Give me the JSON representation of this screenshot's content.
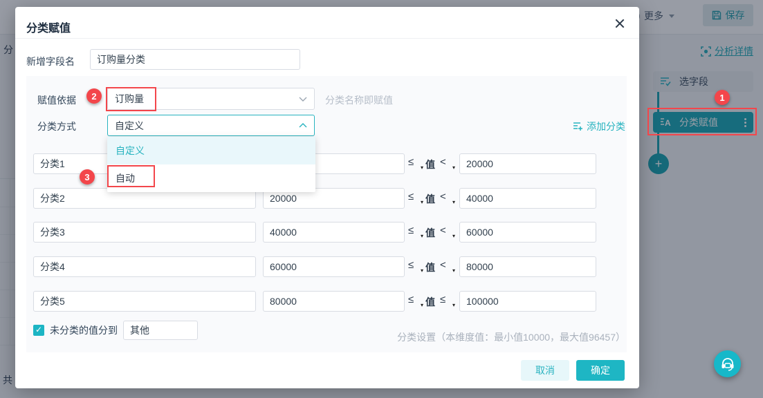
{
  "colors": {
    "accent": "#1eb6c4",
    "annotation_red": "#f3464b",
    "step_active_bg": "#12a5b5"
  },
  "background": {
    "topbar": {
      "more_label": "更多",
      "save_label": "保存"
    },
    "panel": {
      "details_link": "分析详情",
      "step_pick_label": "选字段",
      "step_classify_label": "分类赋值"
    },
    "left_edge": {
      "top_text": "分",
      "bottom_text": "共"
    }
  },
  "modal": {
    "title": "分类赋值",
    "field_name": {
      "label": "新增字段名",
      "value": "订购量分类"
    },
    "basis": {
      "label": "赋值依据",
      "value": "订购量",
      "hint": "分类名称即赋值"
    },
    "method": {
      "label": "分类方式",
      "value": "自定义",
      "add_label": "添加分类",
      "options": {
        "0": "自定义",
        "1": "自动"
      }
    },
    "value_label": "值",
    "rows": [
      {
        "name": "分类1",
        "min": "",
        "op1": "≤",
        "op2": "<",
        "max": "20000"
      },
      {
        "name": "分类2",
        "min": "20000",
        "op1": "≤",
        "op2": "<",
        "max": "40000"
      },
      {
        "name": "分类3",
        "min": "40000",
        "op1": "≤",
        "op2": "<",
        "max": "60000"
      },
      {
        "name": "分类4",
        "min": "60000",
        "op1": "≤",
        "op2": "<",
        "max": "80000"
      },
      {
        "name": "分类5",
        "min": "80000",
        "op1": "≤",
        "op2": "≤",
        "max": "100000"
      }
    ],
    "unclassified": {
      "label": "未分类的值分到",
      "value": "其他",
      "checked": true
    },
    "footnote": "分类设置（本维度值：最小值10000，最大值96457）",
    "cancel_label": "取消",
    "confirm_label": "确定"
  },
  "annotations": {
    "badge1": "1",
    "badge2": "2",
    "badge3": "3"
  }
}
